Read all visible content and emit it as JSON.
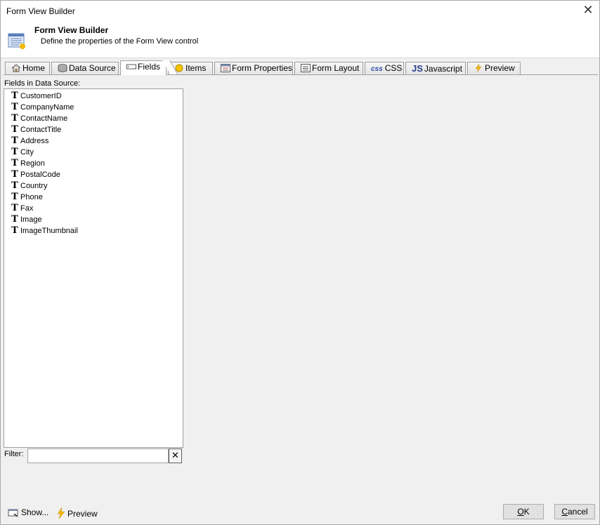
{
  "window": {
    "title": "Form View Builder",
    "close_glyph": "✕"
  },
  "header": {
    "title": "Form View Builder",
    "subtitle": "Define the properties of the Form View control",
    "icon": "form-grid-icon"
  },
  "tabs": [
    {
      "label": "Home",
      "icon": "home-icon"
    },
    {
      "label": "Data Source",
      "icon": "database-icon"
    },
    {
      "label": "Fields",
      "icon": "textbox-icon",
      "active": true
    },
    {
      "label": "Items",
      "icon": "circle-icon"
    },
    {
      "label": "Form Properties",
      "icon": "form-properties-icon"
    },
    {
      "label": "Form Layout",
      "icon": "form-layout-icon"
    },
    {
      "label": "CSS",
      "icon": "css-icon",
      "icon_text": "css"
    },
    {
      "label": "Javascript",
      "icon": "javascript-icon",
      "icon_text": "JS"
    },
    {
      "label": "Preview",
      "icon": "lightning-icon"
    }
  ],
  "fields_panel": {
    "label": "Fields in Data Source:",
    "field_icon_glyph": "T",
    "items": [
      "CustomerID",
      "CompanyName",
      "ContactName",
      "ContactTitle",
      "Address",
      "City",
      "Region",
      "PostalCode",
      "Country",
      "Phone",
      "Fax",
      "Image",
      "ImageThumbnail"
    ]
  },
  "filter": {
    "label": "Filter:",
    "value": "",
    "clear_glyph": "✕"
  },
  "footer": {
    "show_label": "Show...",
    "preview_label": "Preview",
    "ok_label": "OK",
    "cancel_label": "Cancel"
  },
  "colors": {
    "background": "#f0f0f0",
    "panel": "#ffffff",
    "border": "#a0a0a0",
    "lightning": "#f5b800",
    "css_icon": "#2d4fa6",
    "js_icon": "#2a3f8f"
  }
}
